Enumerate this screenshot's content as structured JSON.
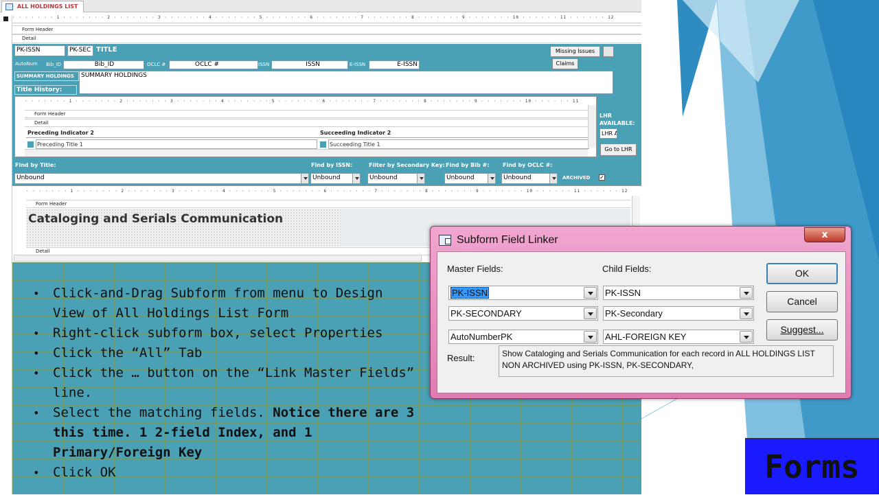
{
  "tab": {
    "title": "ALL HOLDINGS LIST"
  },
  "ruler": {
    "main": "· · · · · · · 1 · · · · · · · 2 · · · · · · · 3 · · · · · · · 4 · · · · · · · 5 · · · · · · · 6 · · · · · · · 7 · · · · · · · 8 · · · · · · · 9 · · · · · · · 10 · · · · · · 11 · · · · · · 12",
    "sub": "· · · · · · · 1 · · · · · · · 2 · · · · · · · 3 · · · · · · · 4 · · · · · · · 5 · · · · · · · 6 · · · · · · · 7 · · · · · · · 8 · · · · · · · 9 · · · · · · · 10 · · · · · · 11"
  },
  "sections": {
    "form_header": "Form Header",
    "detail": "Detail"
  },
  "form": {
    "pk_issn": "PK-ISSN",
    "pk_sec": "PK-SEC",
    "title_label": "TITLE",
    "autonum_label": "AutoNum",
    "bib_label": "Bib_ID",
    "bib_value": "Bib_ID",
    "oclc_label": "OCLC #",
    "oclc_value": "OCLC #",
    "issn_label": "ISSN",
    "issn_value": "ISSN",
    "eissn_label": "E-ISSN",
    "eissn_value": "E-ISSN",
    "summary_label": "SUMMARY HOLDINGS",
    "summary_value": "SUMMARY HOLDINGS",
    "title_history": "Title History:",
    "missing_issues": "Missing Issues",
    "claims": "Claims",
    "lhr_available": "LHR AVAILABLE:",
    "lhr_value": "LHR A",
    "go_to_lhr": "Go to LHR",
    "preceding_indicator": "Preceding Indicator 2",
    "succeeding_indicator": "Succeeding Indicator 2",
    "preceding_title": "Preceding Title 1",
    "succeeding_title": "Succeeding Title 1",
    "find_title": "Find by Title:",
    "find_issn": "Find by ISSN:",
    "filter_sec": "Filter by Secondary Key:",
    "find_bib": "Find by Bib #:",
    "find_oclc": "Find by OCLC #:",
    "unbound": "Unbound",
    "archived": "ARCHIVED",
    "subform_title": "Cataloging and Serials Communication"
  },
  "bullets": {
    "b1": "Click-and-Drag Subform from menu to Design View of All Holdings List Form",
    "b2": "Right-click subform box, select Properties",
    "b3": "Click the “All” Tab",
    "b4": "Click the … button on the “Link Master Fields” line.",
    "b5a": "Select the matching fields. ",
    "b5b": "Notice there are 3 this time.  1 2-field Index, and 1 Primary/Foreign Key",
    "b6": "Click OK"
  },
  "dialog": {
    "title": "Subform Field Linker",
    "close": "x",
    "master_label": "Master Fields:",
    "child_label": "Child Fields:",
    "master": [
      "PK-ISSN",
      "PK-SECONDARY",
      "AutoNumberPK"
    ],
    "child": [
      "PK-ISSN",
      "PK-Secondary",
      "AHL-FOREIGN KEY"
    ],
    "ok": "OK",
    "cancel": "Cancel",
    "suggest": "Suggest...",
    "result_label": "Result:",
    "result_text": "Show Cataloging and Serials Communication for each record in ALL HOLDINGS LIST NON ARCHIVED using PK-ISSN, PK-SECONDARY,"
  },
  "footer": {
    "forms": "Forms"
  },
  "colors": {
    "teal": "#4aa0b4",
    "dialog_pink": "#e17cb3",
    "forms_blue": "#1a1aff",
    "deco_blue": "#3f9ac9"
  }
}
